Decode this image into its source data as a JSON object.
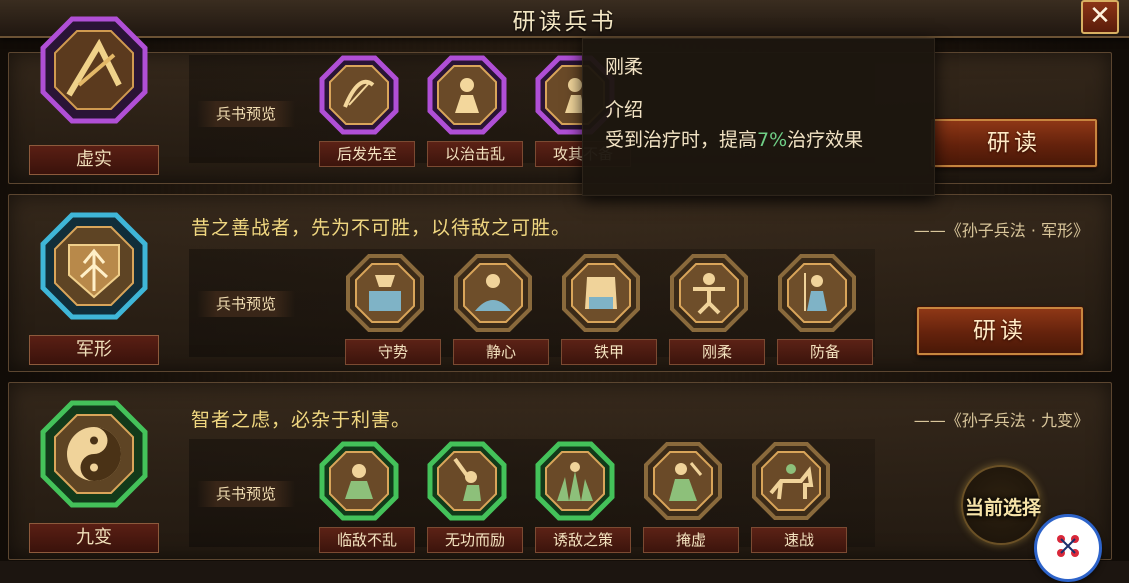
{
  "header": {
    "title": "研读兵书",
    "close_label": "✕"
  },
  "common": {
    "preview_label": "兵书预览",
    "study_label": "研读",
    "current_select_label": "当前选择"
  },
  "books": [
    {
      "name": "虚实",
      "quote": "",
      "source": "",
      "theme": "purple",
      "skills": [
        {
          "label": "后发先至",
          "icon": "bow-arrow-icon"
        },
        {
          "label": "以治击乱",
          "icon": "general-icon"
        },
        {
          "label": "攻其不备",
          "icon": "warrior-icon"
        }
      ]
    },
    {
      "name": "军形",
      "quote": "昔之善战者，先为不可胜，以待敌之可胜。",
      "source": "——《孙子兵法 · 军形》",
      "theme": "blue",
      "skills": [
        {
          "label": "守势",
          "icon": "shield-icon"
        },
        {
          "label": "静心",
          "icon": "meditation-icon"
        },
        {
          "label": "铁甲",
          "icon": "armor-icon"
        },
        {
          "label": "刚柔",
          "icon": "martial-icon"
        },
        {
          "label": "防备",
          "icon": "guard-icon"
        }
      ]
    },
    {
      "name": "九变",
      "quote": "智者之虑，必杂于利害。",
      "source": "——《孙子兵法 · 九变》",
      "theme": "green",
      "skills": [
        {
          "label": "临敌不乱",
          "icon": "calm-icon"
        },
        {
          "label": "无功而励",
          "icon": "sword-raise-icon"
        },
        {
          "label": "诱敌之策",
          "icon": "grass-icon"
        },
        {
          "label": "掩虚",
          "icon": "cloak-icon"
        },
        {
          "label": "速战",
          "icon": "cavalry-icon"
        }
      ]
    }
  ],
  "tooltip": {
    "title": "刚柔",
    "subtitle": "介绍",
    "desc_before": "受到治疗时，提高",
    "desc_value": "7%",
    "desc_after": "治疗效果"
  },
  "colors": {
    "purple": "#b04fd6",
    "blue": "#3fb6d8",
    "green": "#44c25a",
    "gold": "#c9a35a"
  }
}
